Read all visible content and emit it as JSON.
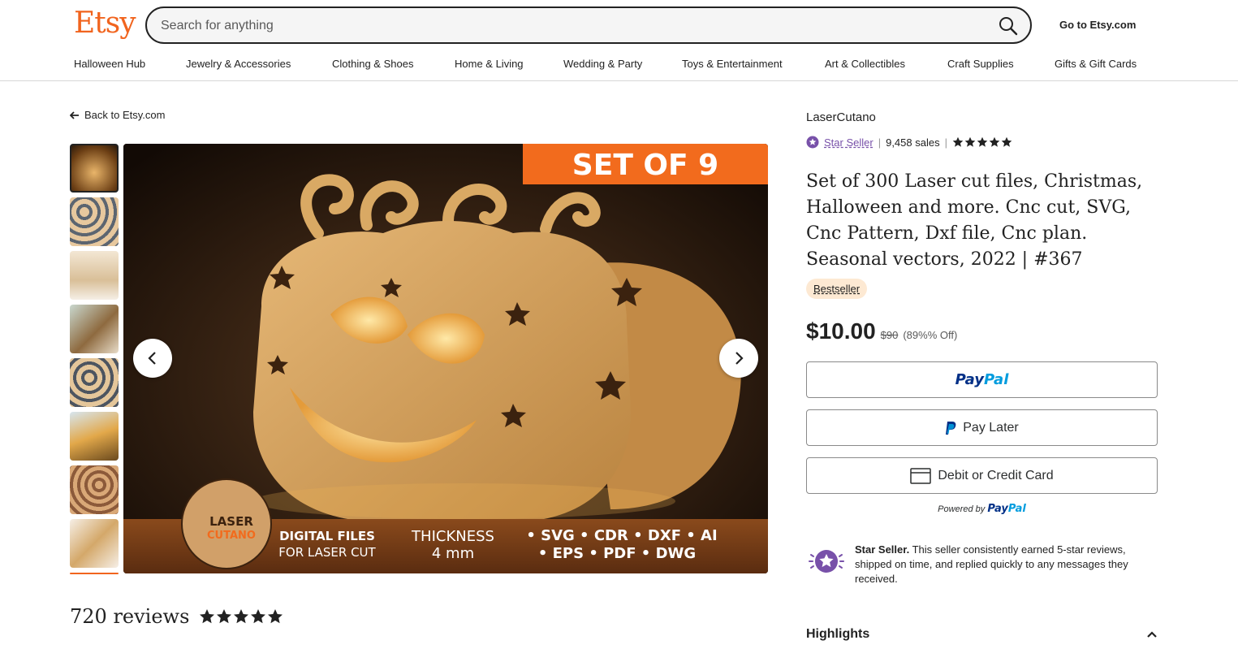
{
  "header": {
    "logo": "Etsy",
    "search_placeholder": "Search for anything",
    "search_value": "",
    "goto_link": "Go to Etsy.com"
  },
  "nav": [
    "Halloween Hub",
    "Jewelry & Accessories",
    "Clothing & Shoes",
    "Home & Living",
    "Wedding & Party",
    "Toys & Entertainment",
    "Art & Collectibles",
    "Craft Supplies",
    "Gifts & Gift Cards"
  ],
  "back_link": "Back to Etsy.com",
  "image": {
    "banner": "SET OF 9",
    "brand_line1": "LASER",
    "brand_line2": "CUTANO",
    "digital_line1": "DIGITAL FILES",
    "digital_line2": "FOR LASER CUT",
    "thickness_label": "THICKNESS",
    "thickness_value": "4 mm",
    "formats_line1": "• SVG • CDR • DXF • AI",
    "formats_line2": "• EPS • PDF • DWG"
  },
  "reviews": {
    "count": "720 reviews",
    "rating_stars": 5
  },
  "listing": {
    "shop_name": "LaserCutano",
    "star_seller": "Star Seller",
    "sales": "9,458 sales",
    "rating_stars": 5,
    "title": "Set of 300 Laser cut files, Christmas, Halloween and more. Cnc cut, SVG, Cnc Pattern, Dxf file, Cnc plan. Seasonal vectors, 2022 | #367",
    "badge": "Bestseller",
    "price": "$10.00",
    "old_price": "$90",
    "discount": "(89%% Off)"
  },
  "payment": {
    "paypal_a": "Pay",
    "paypal_b": "Pal",
    "pay_later": "Pay Later",
    "card": "Debit or Credit Card",
    "powered_by": "Powered by"
  },
  "star_seller_info": {
    "bold": "Star Seller.",
    "text": " This seller consistently earned 5-star reviews, shipped on time, and replied quickly to any messages they received."
  },
  "highlights": "Highlights",
  "colors": {
    "brand": "#f1641e",
    "star_seller": "#7851a9",
    "badge_bg": "#fde9d3",
    "paypal_dark": "#003087",
    "paypal_light": "#009cde"
  }
}
